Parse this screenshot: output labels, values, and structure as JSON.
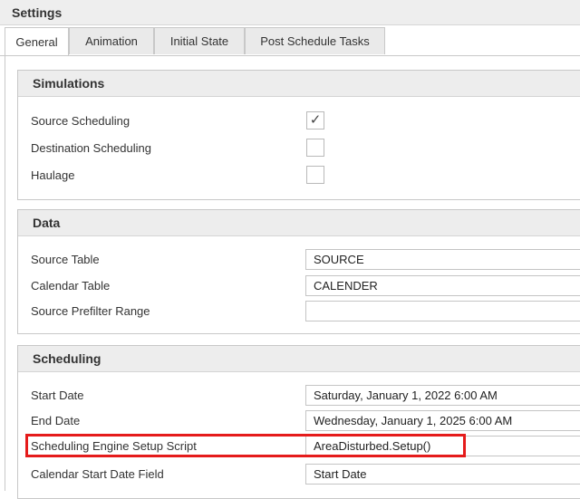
{
  "window": {
    "title": "Settings"
  },
  "tabs": [
    {
      "label": "General",
      "active": true
    },
    {
      "label": "Animation",
      "active": false
    },
    {
      "label": "Initial State",
      "active": false
    },
    {
      "label": "Post Schedule Tasks",
      "active": false
    }
  ],
  "simulations": {
    "header": "Simulations",
    "items": [
      {
        "label": "Source Scheduling",
        "checked": true,
        "mark": "✓"
      },
      {
        "label": "Destination Scheduling",
        "checked": false,
        "mark": ""
      },
      {
        "label": "Haulage",
        "checked": false,
        "mark": ""
      }
    ]
  },
  "data": {
    "header": "Data",
    "items": [
      {
        "label": "Source Table",
        "value": "SOURCE"
      },
      {
        "label": "Calendar Table",
        "value": "CALENDER"
      },
      {
        "label": "Source Prefilter Range",
        "value": ""
      }
    ]
  },
  "scheduling": {
    "header": "Scheduling",
    "items": [
      {
        "label": "Start Date",
        "value": "Saturday, January 1, 2022 6:00 AM"
      },
      {
        "label": "End Date",
        "value": "Wednesday, January 1, 2025 6:00 AM"
      },
      {
        "label": "Scheduling Engine Setup Script",
        "value": "AreaDisturbed.Setup()"
      },
      {
        "label": "Calendar Start Date Field",
        "value": "Start Date"
      }
    ]
  },
  "colors": {
    "highlight": "#e51b1b",
    "header_bg": "#ededed"
  }
}
